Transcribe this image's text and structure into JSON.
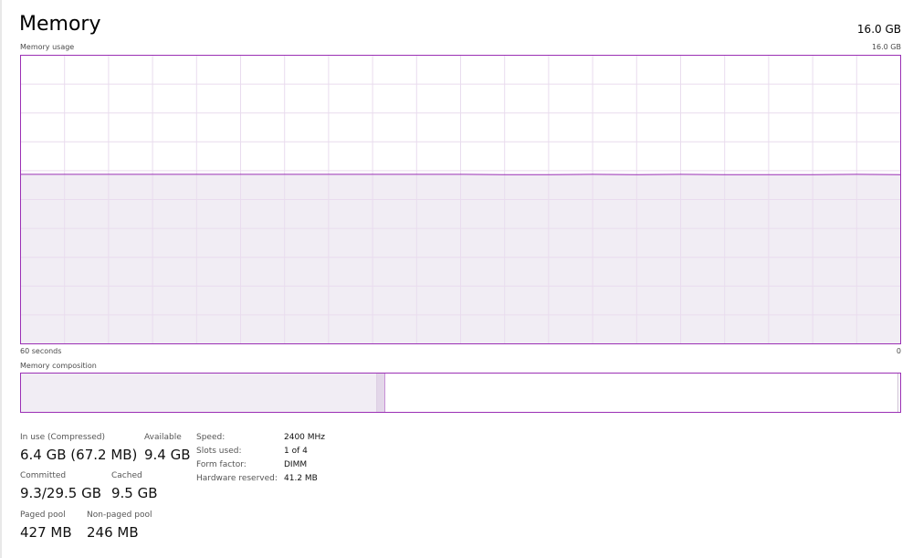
{
  "header": {
    "title": "Memory",
    "total": "16.0 GB"
  },
  "usage_graph": {
    "label": "Memory usage",
    "max_label": "16.0 GB",
    "time_label": "60 seconds",
    "min_label": "0",
    "accent_color": "#9b30b5",
    "fill_color": "#f1edf4",
    "grid_color": "#e9dcee"
  },
  "chart_data": {
    "type": "area",
    "title": "Memory usage",
    "xlabel": "60 seconds",
    "ylabel": "",
    "xlim": [
      60,
      0
    ],
    "ylim": [
      0,
      16.0
    ],
    "grid": true,
    "x": [
      60,
      57,
      54,
      51,
      48,
      45,
      42,
      39,
      36,
      33,
      30,
      27,
      24,
      21,
      18,
      15,
      12,
      9,
      6,
      3,
      0
    ],
    "series": [
      {
        "values": [
          9.4,
          9.4,
          9.4,
          9.4,
          9.4,
          9.4,
          9.4,
          9.4,
          9.4,
          9.4,
          9.4,
          9.38,
          9.38,
          9.4,
          9.38,
          9.4,
          9.38,
          9.38,
          9.38,
          9.4,
          9.38
        ]
      }
    ]
  },
  "composition": {
    "label": "Memory composition",
    "in_use_fraction": 0.405,
    "modified_fraction": 0.009,
    "standby_fraction": 0.586
  },
  "stats": {
    "in_use": {
      "label": "In use (Compressed)",
      "value": "6.4 GB (67.2 MB)"
    },
    "available": {
      "label": "Available",
      "value": "9.4 GB"
    },
    "committed": {
      "label": "Committed",
      "value": "9.3/29.5 GB"
    },
    "cached": {
      "label": "Cached",
      "value": "9.5 GB"
    },
    "paged_pool": {
      "label": "Paged pool",
      "value": "427 MB"
    },
    "non_paged_pool": {
      "label": "Non-paged pool",
      "value": "246 MB"
    }
  },
  "specs": {
    "speed": {
      "label": "Speed:",
      "value": "2400 MHz"
    },
    "slots": {
      "label": "Slots used:",
      "value": "1 of 4"
    },
    "form_factor": {
      "label": "Form factor:",
      "value": "DIMM"
    },
    "reserved": {
      "label": "Hardware reserved:",
      "value": "41.2 MB"
    }
  }
}
